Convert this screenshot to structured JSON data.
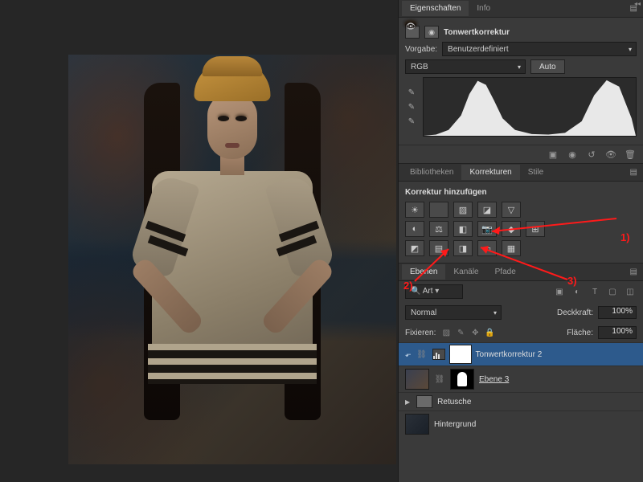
{
  "properties": {
    "tabs": [
      "Eigenschaften",
      "Info"
    ],
    "active_tab": "Eigenschaften",
    "adj_title": "Tonwertkorrektur",
    "preset_label": "Vorgabe:",
    "preset_value": "Benutzerdefiniert",
    "channel_value": "RGB",
    "auto_label": "Auto"
  },
  "corrections": {
    "tabs": [
      "Bibliotheken",
      "Korrekturen",
      "Stile"
    ],
    "active_tab": "Korrekturen",
    "heading": "Korrektur hinzufügen"
  },
  "layers": {
    "tabs": [
      "Ebenen",
      "Kanäle",
      "Pfade"
    ],
    "active_tab": "Ebenen",
    "filter_value": "Art",
    "blend_value": "Normal",
    "opacity_label": "Deckkraft:",
    "opacity_value": "100%",
    "lock_label": "Fixieren:",
    "fill_label": "Fläche:",
    "fill_value": "100%",
    "items": [
      {
        "name": "Tonwertkorrektur 2"
      },
      {
        "name": "Ebene 3"
      },
      {
        "name": "Retusche"
      },
      {
        "name": "Hintergrund"
      }
    ]
  },
  "annotations": {
    "a1": "1)",
    "a2": "2)",
    "a3": "3)"
  },
  "chart_data": {
    "type": "area",
    "title": "",
    "xlabel": "",
    "ylabel": "",
    "xlim": [
      0,
      255
    ],
    "ylim": [
      0,
      100
    ],
    "series": [
      {
        "name": "RGB histogram",
        "x": [
          0,
          15,
          30,
          45,
          55,
          65,
          75,
          85,
          95,
          110,
          130,
          150,
          170,
          190,
          205,
          220,
          235,
          250,
          255
        ],
        "values": [
          0,
          2,
          10,
          35,
          72,
          95,
          88,
          60,
          30,
          10,
          3,
          2,
          5,
          25,
          70,
          96,
          85,
          30,
          0
        ]
      }
    ]
  }
}
